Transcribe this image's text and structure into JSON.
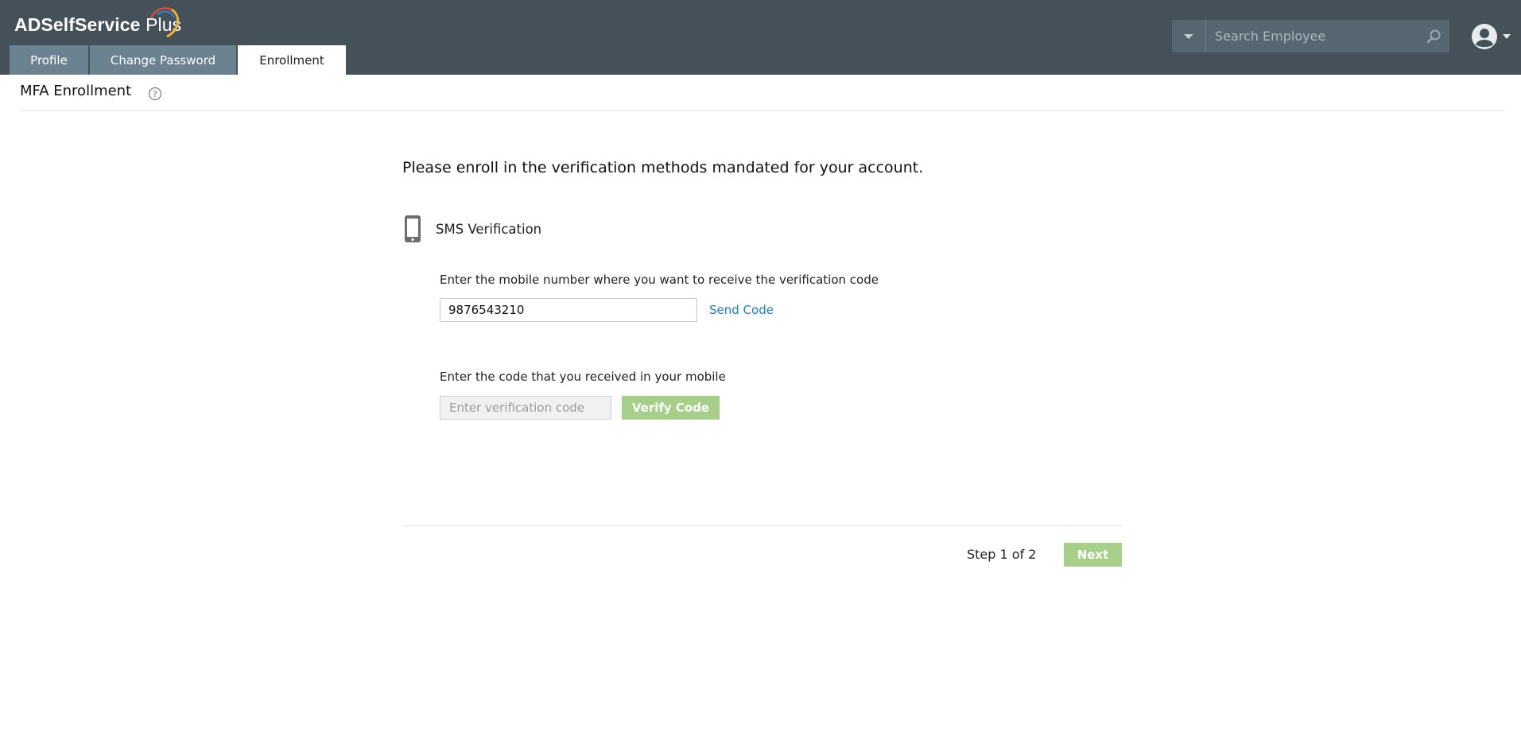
{
  "header": {
    "logo_brand": "ADSelfService",
    "logo_suffix": "Plus",
    "tabs": [
      {
        "label": "Profile",
        "active": false
      },
      {
        "label": "Change Password",
        "active": false
      },
      {
        "label": "Enrollment",
        "active": true
      }
    ],
    "search": {
      "placeholder": "Search Employee",
      "dropdown_icon": "caret-down-icon",
      "search_icon": "search-icon"
    },
    "user_menu": {
      "icon": "user-avatar-icon",
      "caret_icon": "caret-down-icon"
    }
  },
  "page": {
    "title": "MFA Enrollment",
    "help_icon": "question-circle-icon"
  },
  "enrollment": {
    "heading": "Please enroll in the verification methods mandated for your account.",
    "method": {
      "icon": "mobile-phone-icon",
      "label": "SMS Verification"
    },
    "mobile_prompt": "Enter the mobile number where you want to receive the verification code",
    "mobile_value": "9876543210",
    "send_code_label": "Send Code",
    "code_prompt": "Enter the code that you received in your mobile",
    "code_placeholder": "Enter verification code",
    "verify_label": "Verify Code"
  },
  "footer": {
    "step_text": "Step 1 of 2",
    "next_label": "Next"
  },
  "colors": {
    "header_bg": "#445159",
    "tab_bg": "#6b8290",
    "link": "#1a7ec1",
    "button_green": "#a6d08a"
  }
}
